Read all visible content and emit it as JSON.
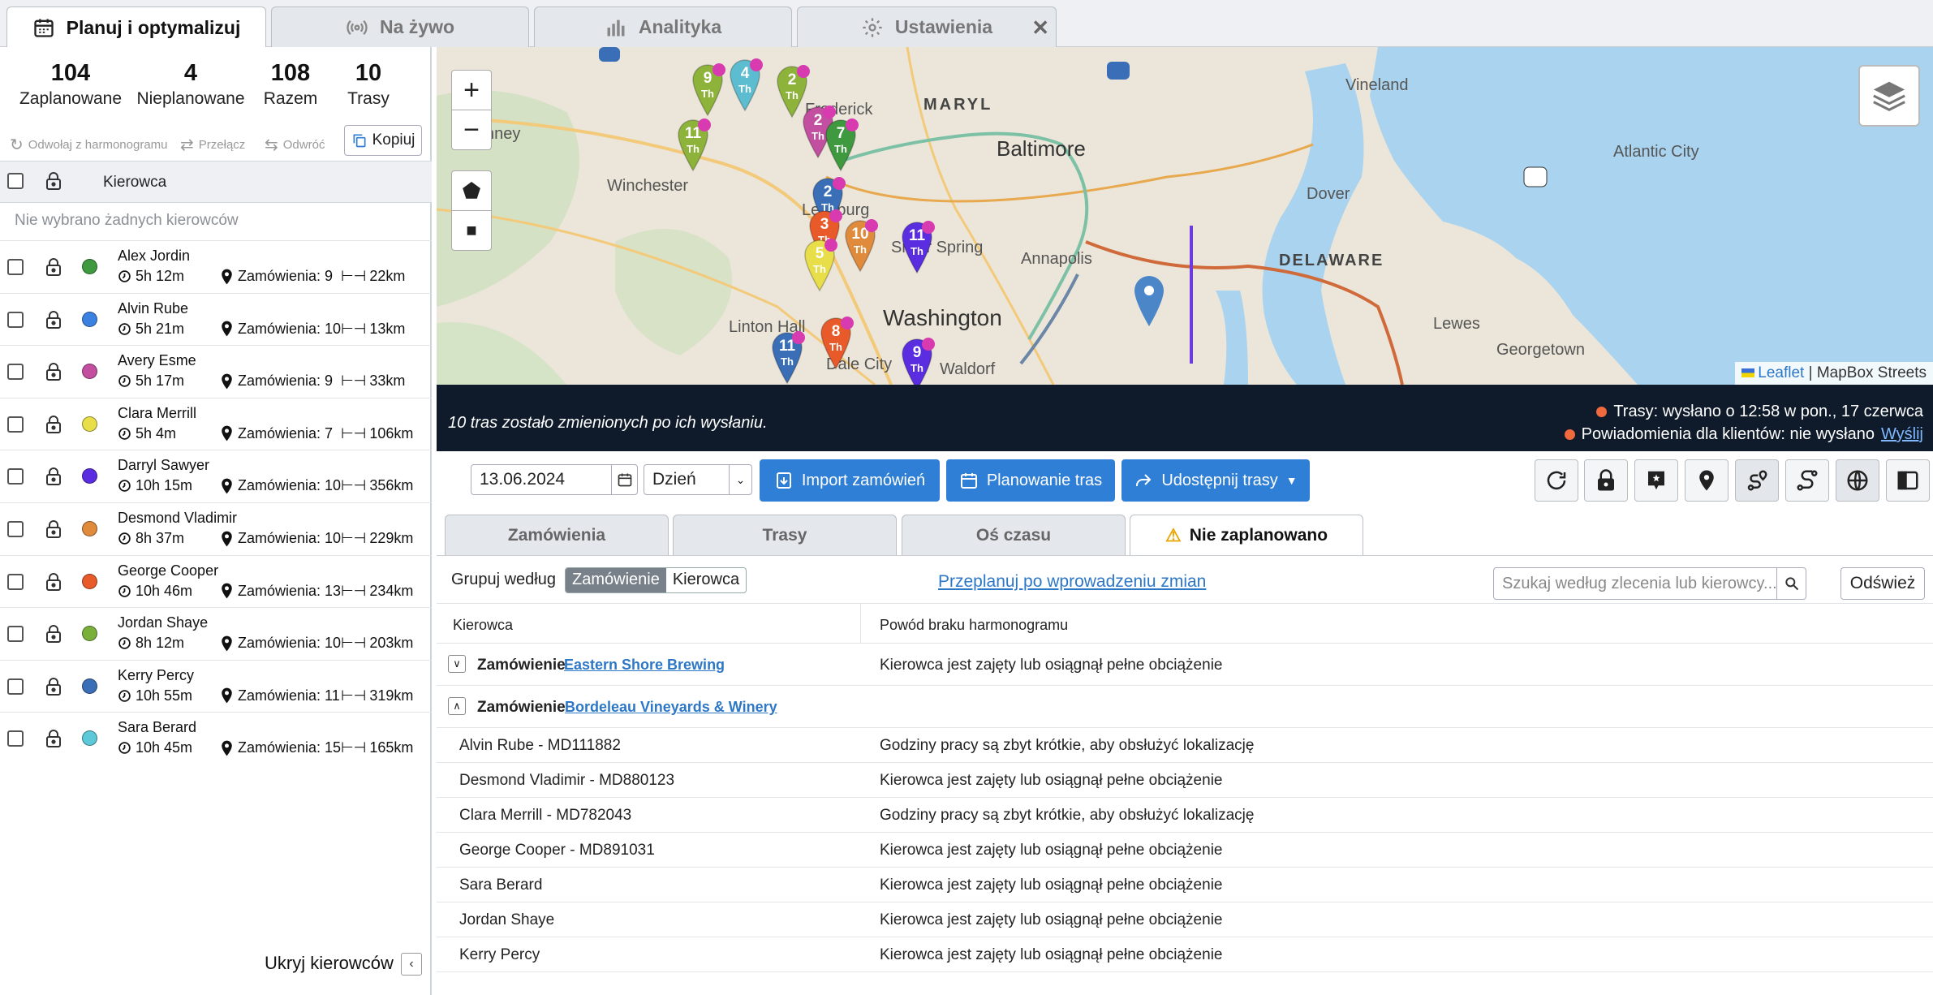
{
  "tabs": [
    {
      "label": "Planuj i optymalizuj",
      "icon": "calendar-icon",
      "active": true
    },
    {
      "label": "Na żywo",
      "icon": "broadcast-icon",
      "active": false
    },
    {
      "label": "Analityka",
      "icon": "bar-chart-icon",
      "active": false
    },
    {
      "label": "Ustawienia",
      "icon": "gear-icon",
      "active": false
    }
  ],
  "stats": [
    {
      "value": "104",
      "label": "Zaplanowane"
    },
    {
      "value": "4",
      "label": "Nieplanowane"
    },
    {
      "value": "108",
      "label": "Razem"
    },
    {
      "value": "10",
      "label": "Trasy"
    }
  ],
  "actions": {
    "unschedule": "Odwołaj z harmonogramu",
    "switch": "Przełącz",
    "reverse": "Odwróć",
    "copy": "Kopiuj"
  },
  "drivers_header": "Kierowca",
  "no_selection": "Nie wybrano żadnych kierowców",
  "drivers": [
    {
      "name": "Alex Jordin",
      "time": "5h 12m",
      "orders": "Zamówienia: 9",
      "km": "22km",
      "color": "#3f9a3f"
    },
    {
      "name": "Alvin Rube",
      "time": "5h 21m",
      "orders": "Zamówienia: 10",
      "km": "13km",
      "color": "#3b82e0"
    },
    {
      "name": "Avery Esme",
      "time": "5h 17m",
      "orders": "Zamówienia: 9",
      "km": "33km",
      "color": "#c24fa0"
    },
    {
      "name": "Clara Merrill",
      "time": "5h 4m",
      "orders": "Zamówienia: 7",
      "km": "106km",
      "color": "#e8de4a"
    },
    {
      "name": "Darryl Sawyer",
      "time": "10h 15m",
      "orders": "Zamówienia: 10",
      "km": "356km",
      "color": "#5a2ee0"
    },
    {
      "name": "Desmond Vladimir",
      "time": "8h 37m",
      "orders": "Zamówienia: 10",
      "km": "229km",
      "color": "#e08a3c"
    },
    {
      "name": "George Cooper",
      "time": "10h 46m",
      "orders": "Zamówienia: 13",
      "km": "234km",
      "color": "#e85a2a"
    },
    {
      "name": "Jordan Shaye",
      "time": "8h 12m",
      "orders": "Zamówienia: 10",
      "km": "203km",
      "color": "#7ab03a"
    },
    {
      "name": "Kerry Percy",
      "time": "10h 55m",
      "orders": "Zamówienia: 11",
      "km": "319km",
      "color": "#3a6fb8"
    },
    {
      "name": "Sara Berard",
      "time": "10h 45m",
      "orders": "Zamówienia: 15",
      "km": "165km",
      "color": "#5cc8d8"
    }
  ],
  "hide_drivers": "Ukryj kierowców",
  "map": {
    "labels": [
      "Vineland",
      "Frederick",
      "Baltimore",
      "Atlantic City",
      "Winchester",
      "Dover",
      "Leesburg",
      "Silver Spring",
      "Annapolis",
      "DELAWARE",
      "Washington",
      "Linton Hall",
      "Dale City",
      "Lewes",
      "Georgetown",
      "Waldorf",
      "MARYL",
      "nney"
    ],
    "attribution_link": "Leaflet",
    "attribution_rest": "| MapBox Streets",
    "pins": [
      {
        "num": "9",
        "color": "#8db33a"
      },
      {
        "num": "4",
        "color": "#5cbcd0"
      },
      {
        "num": "2",
        "color": "#8db33a"
      },
      {
        "num": "11",
        "color": "#8db33a"
      },
      {
        "num": "2",
        "color": "#c24fa0"
      },
      {
        "num": "7",
        "color": "#3f9a3f"
      },
      {
        "num": "2",
        "color": "#3a6fb8"
      },
      {
        "num": "3",
        "color": "#e85a2a"
      },
      {
        "num": "10",
        "color": "#e08a3c"
      },
      {
        "num": "5",
        "color": "#e8de4a"
      },
      {
        "num": "11",
        "color": "#5a2ee0"
      },
      {
        "num": "8",
        "color": "#e85a2a"
      },
      {
        "num": "11",
        "color": "#3a6fb8"
      },
      {
        "num": "9",
        "color": "#5a2ee0"
      }
    ]
  },
  "banner": {
    "message": "10 tras zostało zmienionych po ich wysłaniu.",
    "routes_status": "Trasy: wysłano o 12:58 w pon., 17 czerwca",
    "notify_status": "Powiadomienia dla klientów: nie wysłano",
    "send_link": "Wyślij"
  },
  "toolbar": {
    "date": "13.06.2024",
    "period": "Dzień",
    "import": "Import zamówień",
    "planning": "Planowanie tras",
    "share": "Udostępnij trasy"
  },
  "subtabs": [
    {
      "label": "Zamówienia"
    },
    {
      "label": "Trasy"
    },
    {
      "label": "Oś czasu"
    },
    {
      "label": "Nie zaplanowano",
      "active": true
    }
  ],
  "table": {
    "group_by": "Grupuj według",
    "group_opts": [
      "Zamówienie",
      "Kierowca"
    ],
    "replan": "Przeplanuj po wprowadzeniu zmian",
    "search_placeholder": "Szukaj według zlecenia lub kierowcy...",
    "refresh": "Odśwież",
    "col1": "Kierowca",
    "col2": "Powód braku harmonogramu",
    "group_label": "Zamówienie",
    "groups": [
      {
        "name": "Eastern Shore Brewing",
        "reason": "Kierowca jest zajęty lub osiągnął pełne obciążenie",
        "toggle": "∨"
      },
      {
        "name": "Bordeleau Vineyards & Winery",
        "reason": "",
        "toggle": "∧"
      }
    ],
    "rows": [
      {
        "driver": "Alvin Rube - MD111882",
        "reason": "Godziny pracy są zbyt krótkie, aby obsłużyć lokalizację"
      },
      {
        "driver": "Desmond Vladimir - MD880123",
        "reason": "Kierowca jest zajęty lub osiągnął pełne obciążenie"
      },
      {
        "driver": "Clara Merrill - MD782043",
        "reason": "Godziny pracy są zbyt krótkie, aby obsłużyć lokalizację"
      },
      {
        "driver": "George Cooper - MD891031",
        "reason": "Kierowca jest zajęty lub osiągnął pełne obciążenie"
      },
      {
        "driver": "Sara Berard",
        "reason": "Kierowca jest zajęty lub osiągnął pełne obciążenie"
      },
      {
        "driver": "Jordan Shaye",
        "reason": "Kierowca jest zajęty lub osiągnął pełne obciążenie"
      },
      {
        "driver": "Kerry Percy",
        "reason": "Kierowca jest zajęty lub osiągnął pełne obciążenie"
      }
    ]
  }
}
